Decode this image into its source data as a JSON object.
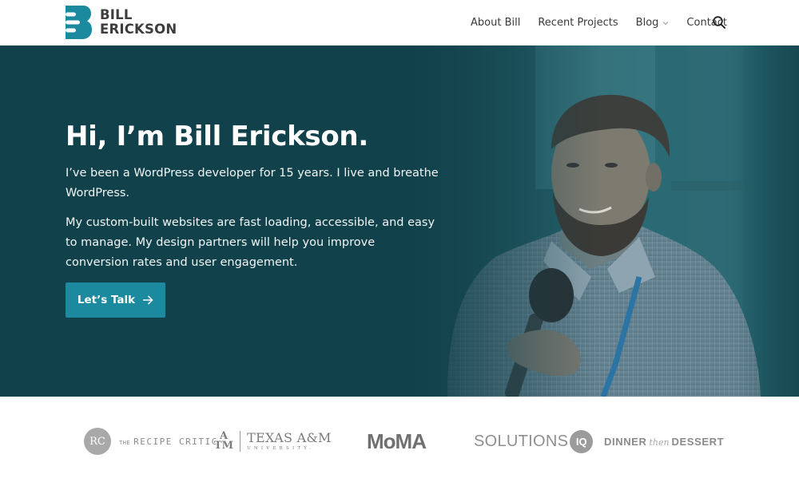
{
  "header": {
    "logo": {
      "line1": "BILL",
      "line2": "ERICKSON",
      "brand_color": "#1b8a9f"
    },
    "nav": [
      {
        "label": "About Bill",
        "has_dropdown": false
      },
      {
        "label": "Recent Projects",
        "has_dropdown": false
      },
      {
        "label": "Blog",
        "has_dropdown": true
      },
      {
        "label": "Contact",
        "has_dropdown": false
      }
    ],
    "search_icon": "search-icon"
  },
  "hero": {
    "title": "Hi, I’m Bill Erickson.",
    "paragraphs": [
      "I’ve been a WordPress developer for 15 years. I live and breathe WordPress.",
      "My custom-built websites are fast loading, accessible, and easy to manage. My design partners will help you improve conversion rates and user engagement."
    ],
    "cta": {
      "label": "Let’s Talk",
      "icon": "arrow-right-icon"
    },
    "background_color": "#11414a",
    "button_color": "#1b8a9f",
    "photo_alt": "Bill Erickson speaking into a microphone"
  },
  "clients": {
    "logos": [
      {
        "name": "The Recipe Critic",
        "mark": "RC",
        "prefix": "THE",
        "text": "RECIPE CRITIC"
      },
      {
        "name": "Texas A&M University",
        "mark_top": "A",
        "mark_bottom": "TM",
        "text": "TEXAS A&M",
        "sub": "UNIVERSITY."
      },
      {
        "name": "MoMA",
        "text": "MoMA"
      },
      {
        "name": "Solutions IQ",
        "text": "SOLUTIONS",
        "badge": "IQ"
      },
      {
        "name": "Dinner then Dessert",
        "left": "DINNER",
        "middle": "then",
        "right": "DESSERT"
      }
    ]
  }
}
